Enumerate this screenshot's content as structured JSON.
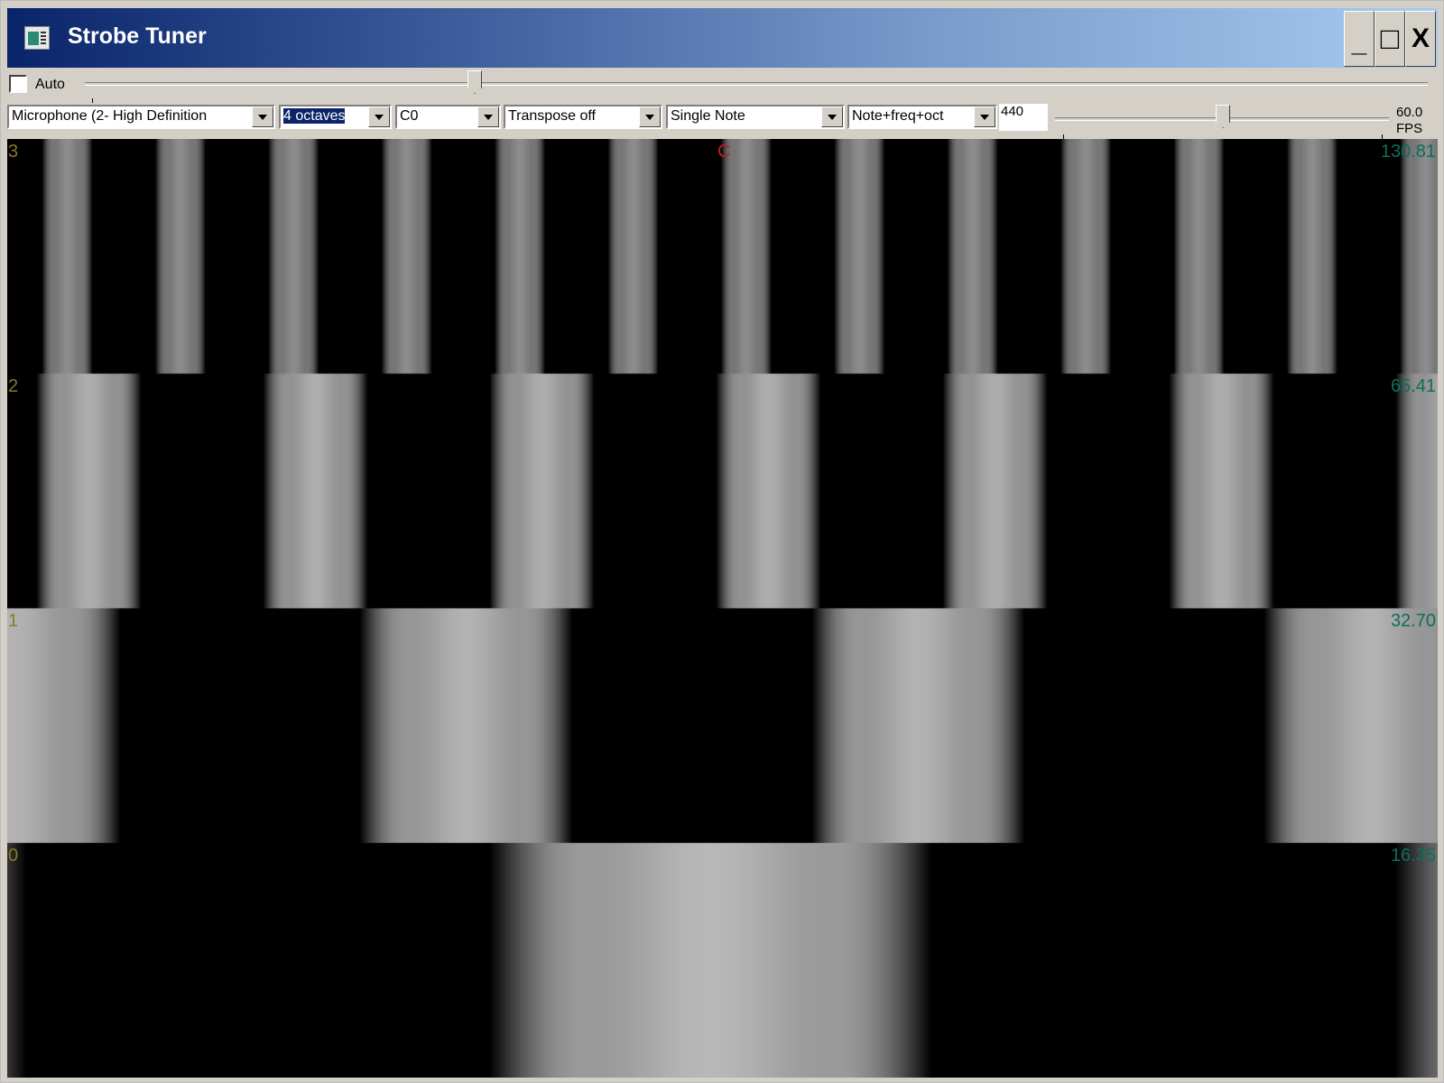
{
  "window": {
    "title": "Strobe Tuner",
    "controls": {
      "minimize": "_",
      "maximize": "□",
      "close": "X"
    }
  },
  "toolbar": {
    "auto_label": "Auto",
    "auto_checked": false,
    "input_device": "Microphone (2- High Definition",
    "octaves": "4 octaves",
    "start_note": "C0",
    "transpose": "Transpose off",
    "mode": "Single Note",
    "display": "Note+freq+oct",
    "reference_freq": "440",
    "fps_value": "60.0",
    "fps_unit": "FPS"
  },
  "strobe": {
    "note": "C",
    "bands": [
      {
        "octave": "3",
        "freq": "130.81"
      },
      {
        "octave": "2",
        "freq": "65.41"
      },
      {
        "octave": "1",
        "freq": "32.70"
      },
      {
        "octave": "0",
        "freq": "16.35"
      }
    ]
  }
}
